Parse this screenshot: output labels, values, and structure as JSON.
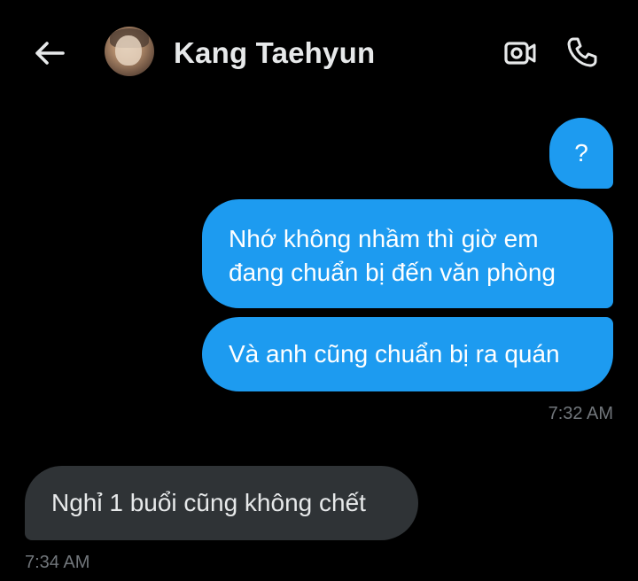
{
  "header": {
    "contact_name": "Kang Taehyun",
    "icons": {
      "back": "arrow-left-icon",
      "video": "video-camera-icon",
      "call": "phone-icon"
    }
  },
  "colors": {
    "background": "#000000",
    "outgoing_bubble": "#1d9bf0",
    "incoming_bubble": "#2f3336",
    "timestamp": "#71767b"
  },
  "messages": [
    {
      "direction": "outgoing",
      "text": "?"
    },
    {
      "direction": "outgoing",
      "text": "Nhớ không nhầm thì giờ em đang chuẩn bị đến văn phòng"
    },
    {
      "direction": "outgoing",
      "text": "Và anh cũng chuẩn bị ra quán",
      "time": "7:32 AM"
    },
    {
      "direction": "incoming",
      "text": "Nghỉ 1 buổi cũng không chết",
      "time": "7:34 AM"
    }
  ]
}
